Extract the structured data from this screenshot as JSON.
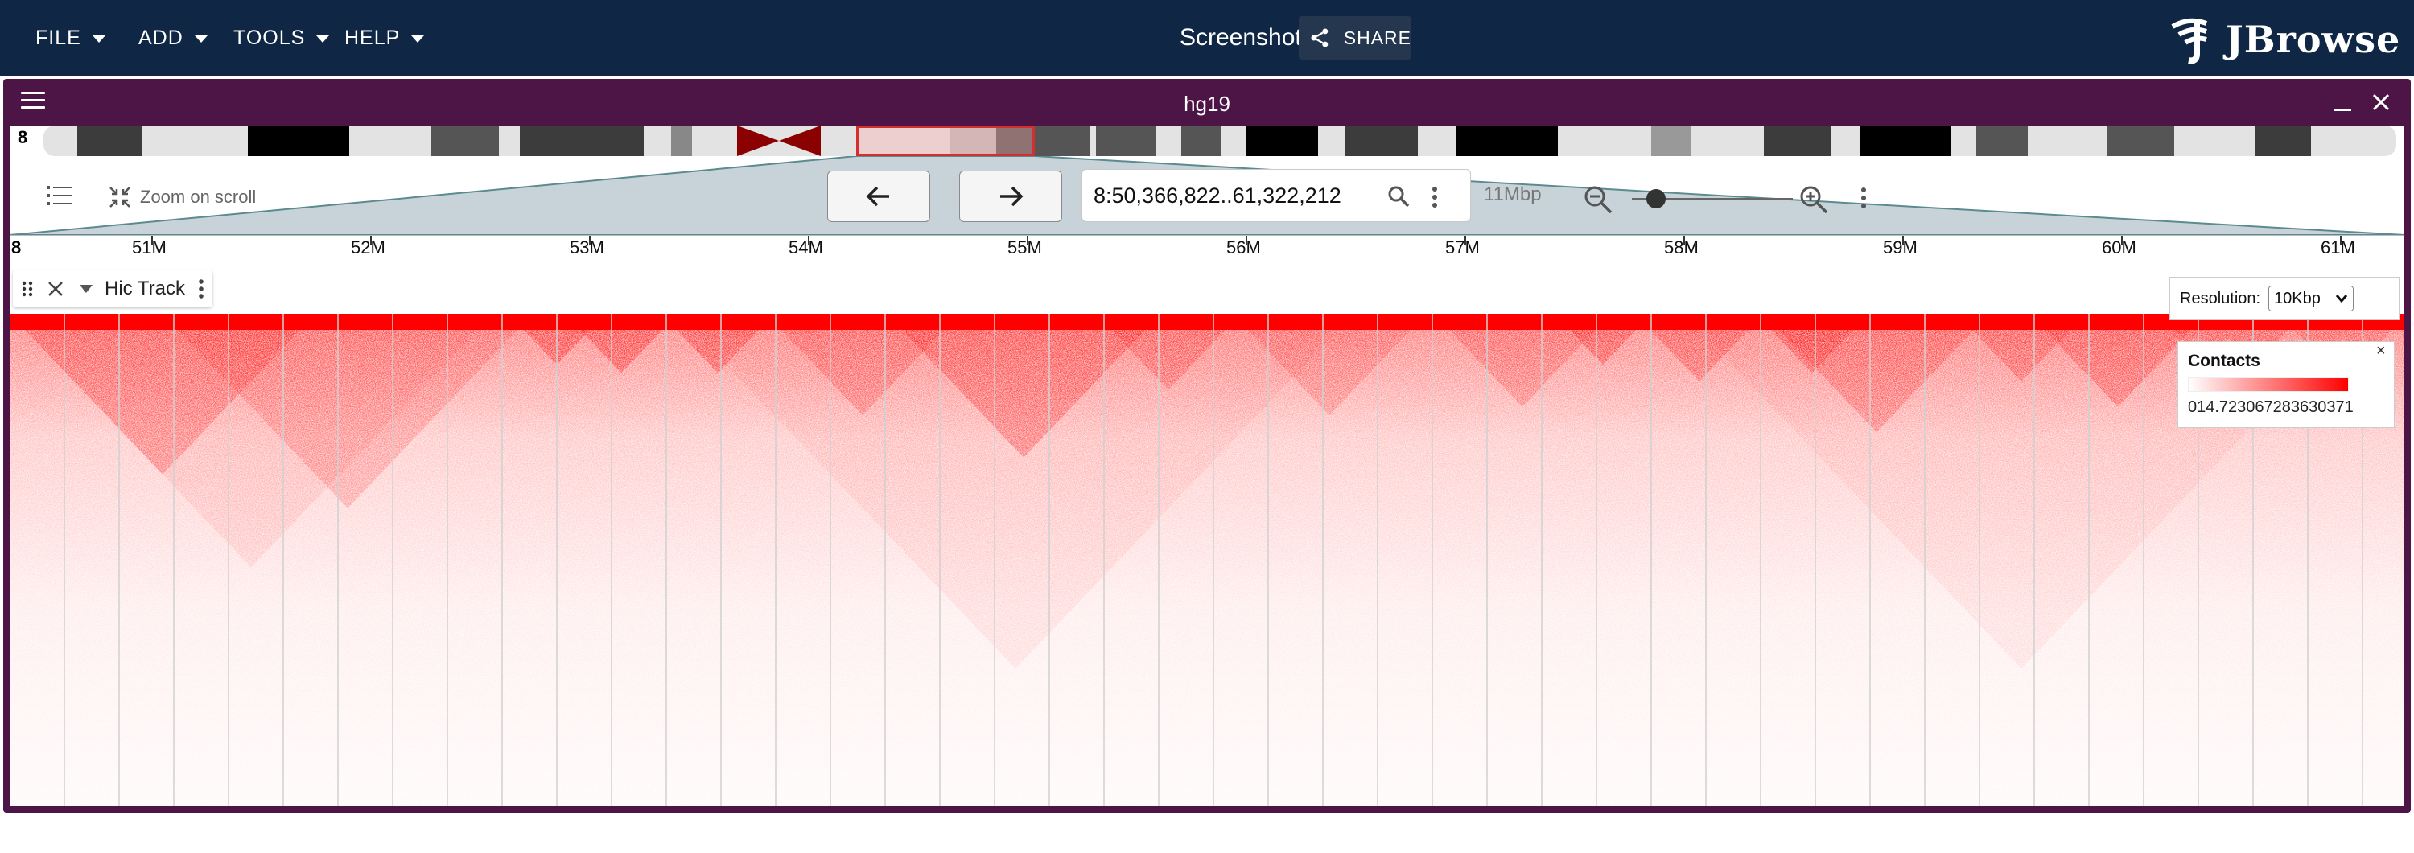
{
  "appbar": {
    "menus": [
      {
        "label": "FILE"
      },
      {
        "label": "ADD"
      },
      {
        "label": "TOOLS"
      },
      {
        "label": "HELP"
      }
    ],
    "session_title": "Screenshot",
    "share_label": "SHARE",
    "logo_text": "JBrowse"
  },
  "view": {
    "title": "hg19",
    "chromosome": "8",
    "zoom_on_scroll_label": "Zoom on scroll",
    "location": "8:50,366,822..61,322,212",
    "bp_per_view": "11Mbp",
    "ruler": {
      "chromosome": "8",
      "labels": [
        "51M",
        "52M",
        "53M",
        "54M",
        "55M",
        "56M",
        "57M",
        "58M",
        "59M",
        "60M",
        "61M"
      ]
    }
  },
  "track": {
    "name": "Hic Track",
    "resolution_label": "Resolution:",
    "resolution_value": "10Kbp",
    "legend": {
      "title": "Contacts",
      "min": "0",
      "max": "14.723067283630371",
      "range_text": "014.723067283630371",
      "close_label": "×"
    }
  },
  "colors": {
    "appbar_bg": "#0f2744",
    "view_header_bg": "#4c1545",
    "contact_color": "#ff0000",
    "region_highlight": "#d32f2f"
  }
}
